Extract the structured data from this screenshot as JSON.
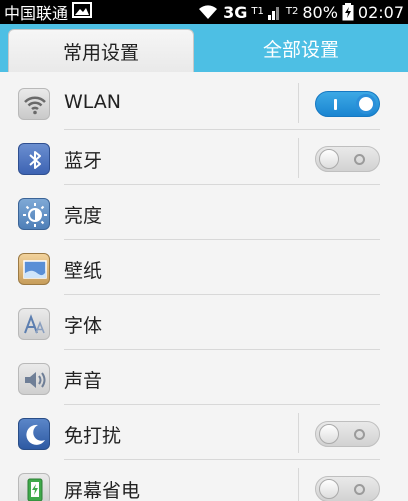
{
  "status_bar": {
    "carrier": "中国联通",
    "network": "3G",
    "tiny_indicator_1": "T1",
    "tiny_indicator_2": "T2",
    "battery": "80%",
    "time": "02:07"
  },
  "tabs": [
    {
      "label": "常用设置",
      "active": true
    },
    {
      "label": "全部设置",
      "active": false
    }
  ],
  "settings": [
    {
      "label": "WLAN",
      "icon": "wifi-icon",
      "toggle": "on"
    },
    {
      "label": "蓝牙",
      "icon": "bluetooth-icon",
      "toggle": "off"
    },
    {
      "label": "亮度",
      "icon": "brightness-icon"
    },
    {
      "label": "壁纸",
      "icon": "wallpaper-icon"
    },
    {
      "label": "字体",
      "icon": "font-icon"
    },
    {
      "label": "声音",
      "icon": "sound-icon"
    },
    {
      "label": "免打扰",
      "icon": "moon-icon",
      "toggle": "off"
    },
    {
      "label": "屏幕省电",
      "icon": "battery-saver-icon",
      "toggle": "off"
    }
  ],
  "colors": {
    "tab_bar": "#4dbfe4",
    "toggle_on": "#2b8fd9",
    "background": "#f4f4f4"
  }
}
